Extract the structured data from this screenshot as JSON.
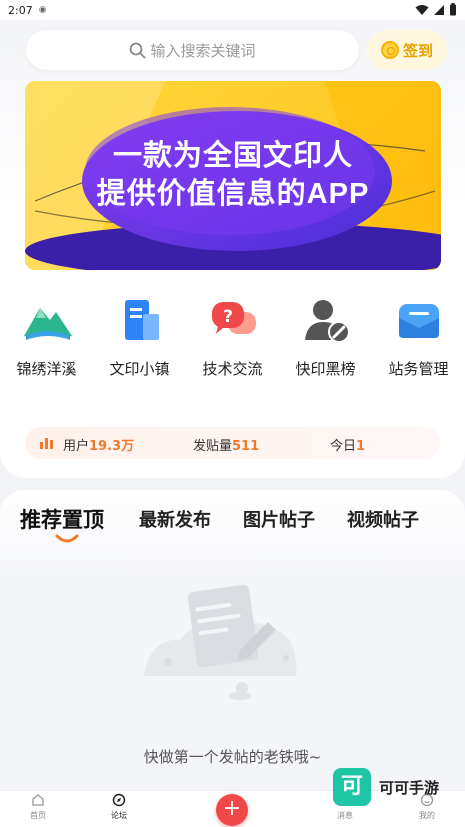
{
  "status_bar": {
    "time": "2:07"
  },
  "search": {
    "placeholder": "输入搜索关键词"
  },
  "checkin": {
    "label": "签到"
  },
  "banner": {
    "line1": "一款为全国文印人",
    "line2": "提供价值信息的APP"
  },
  "quick_nav": [
    {
      "label": "锦绣洋溪",
      "icon": "mountain-icon"
    },
    {
      "label": "文印小镇",
      "icon": "building-icon"
    },
    {
      "label": "技术交流",
      "icon": "chat-question-icon"
    },
    {
      "label": "快印黑榜",
      "icon": "user-ban-icon"
    },
    {
      "label": "站务管理",
      "icon": "mail-icon"
    }
  ],
  "stats": {
    "users_label": "用户",
    "users_value": "19.3万",
    "posts_label": "发贴量",
    "posts_value": "511",
    "today_label": "今日",
    "today_value": "1"
  },
  "tabs": [
    "推荐置顶",
    "最新发布",
    "图片帖子",
    "视频帖子"
  ],
  "empty_state": {
    "text": "快做第一个发帖的老铁哦~"
  },
  "bottom_nav": {
    "home": "首页",
    "forum": "论坛",
    "messages": "消息",
    "me": "我的"
  },
  "watermark": {
    "logo": "可",
    "text": "可可手游"
  },
  "colors": {
    "accent_orange": "#f07a2a",
    "banner_yellow": "#ffc21a",
    "banner_purple": "#6a34e0",
    "post_button_red": "#f04848"
  }
}
